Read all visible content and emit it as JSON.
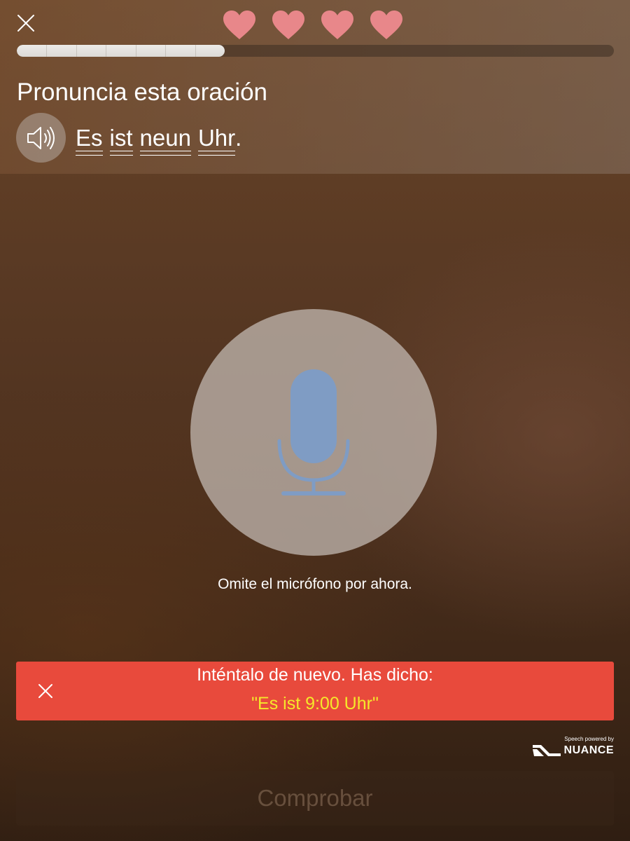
{
  "header": {
    "close_icon": "close-icon",
    "lives": {
      "count": 4,
      "icon": "heart-icon",
      "color": "#e8878a"
    },
    "progress": {
      "fraction": 0.348,
      "segments": 7
    }
  },
  "exercise": {
    "instruction": "Pronuncia esta oración",
    "speaker_icon": "speaker-icon",
    "sentence_words": [
      "Es",
      "ist",
      "neun",
      "Uhr"
    ],
    "sentence_end": "."
  },
  "microphone": {
    "icon": "microphone-icon",
    "icon_color": "#7f9cc4",
    "skip_label": "Omite el micrófono por ahora."
  },
  "feedback": {
    "message": "Inténtalo de nuevo. Has dicho:",
    "heard": "\"Es ist 9:00 Uhr\"",
    "background": "#e84a3c",
    "heard_color": "#f5e82a"
  },
  "attribution": {
    "caption": "Speech powered by",
    "brand": "NUANCE"
  },
  "footer": {
    "check_label": "Comprobar"
  }
}
